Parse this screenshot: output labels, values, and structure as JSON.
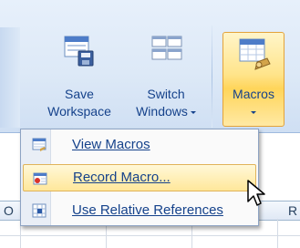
{
  "ribbon": {
    "save_workspace": {
      "line1": "Save",
      "line2": "Workspace"
    },
    "switch_windows": {
      "line1": "Switch",
      "line2": "Windows"
    },
    "macros": {
      "label": "Macros"
    }
  },
  "menu": {
    "items": [
      {
        "label": "View Macros",
        "icon": "view-macros-icon"
      },
      {
        "label": "Record Macro...",
        "icon": "record-macro-icon",
        "highlighted": true
      },
      {
        "label": "Use Relative References",
        "icon": "relative-references-icon"
      }
    ]
  },
  "sheet": {
    "column_headers": [
      "O",
      "R"
    ]
  },
  "colors": {
    "ribbon_text": "#15428b",
    "highlight_border": "#e3a33a",
    "highlight_fill": "#ffe48a"
  }
}
